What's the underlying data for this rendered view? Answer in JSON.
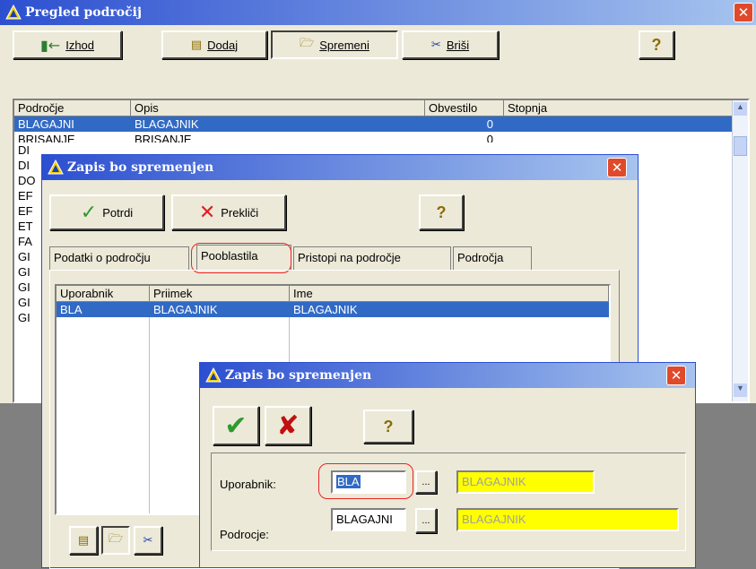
{
  "main": {
    "title": "Pregled področij",
    "close": "✕",
    "toolbar": {
      "exit": "Izhod",
      "add": "Dodaj",
      "edit": "Spremeni",
      "delete": "Briši",
      "help_icon": "?"
    },
    "columns": [
      "Področje",
      "Opis",
      "Obvestilo",
      "Stopnja"
    ],
    "rows": [
      {
        "podrocje": "BLAGAJNI",
        "opis": "BLAGAJNIK",
        "obvestilo": "0",
        "stopnja": ""
      },
      {
        "podrocje": "BRISANJE",
        "opis": "BRISANJE",
        "obvestilo": "0",
        "stopnja": ""
      }
    ],
    "partial_rows": [
      "DI",
      "DI",
      "DO",
      "EF",
      "EF",
      "ET",
      "FA",
      "GI",
      "GI",
      "GI",
      "GI",
      "GI"
    ]
  },
  "dialog1": {
    "title": "Zapis bo spremenjen",
    "close": "✕",
    "confirm": "Potrdi",
    "cancel": "Prekliči",
    "help_icon": "?",
    "tabs": [
      "Podatki o področju",
      "Pooblastila",
      "Pristopi na področje",
      "Področja"
    ],
    "columns": [
      "Uporabnik",
      "Priimek",
      "Ime"
    ],
    "rows": [
      {
        "uporabnik": "BLA",
        "priimek": "BLAGAJNIK",
        "ime": "BLAGAJNIK"
      }
    ]
  },
  "dialog2": {
    "title": "Zapis bo spremenjen",
    "close": "✕",
    "help_icon": "?",
    "fields": {
      "user_label": "Uporabnik:",
      "user_value": "BLA",
      "user_lookup": "...",
      "user_desc": "BLAGAJNIK",
      "area_label": "Podrocje:",
      "area_value": "BLAGAJNI",
      "area_lookup": "...",
      "area_desc": "BLAGAJNIK"
    }
  },
  "colors": {
    "selection": "#316ac5",
    "title_start": "#2c4fd0",
    "highlight_field": "#ffff00",
    "annotation": "#e22222"
  }
}
